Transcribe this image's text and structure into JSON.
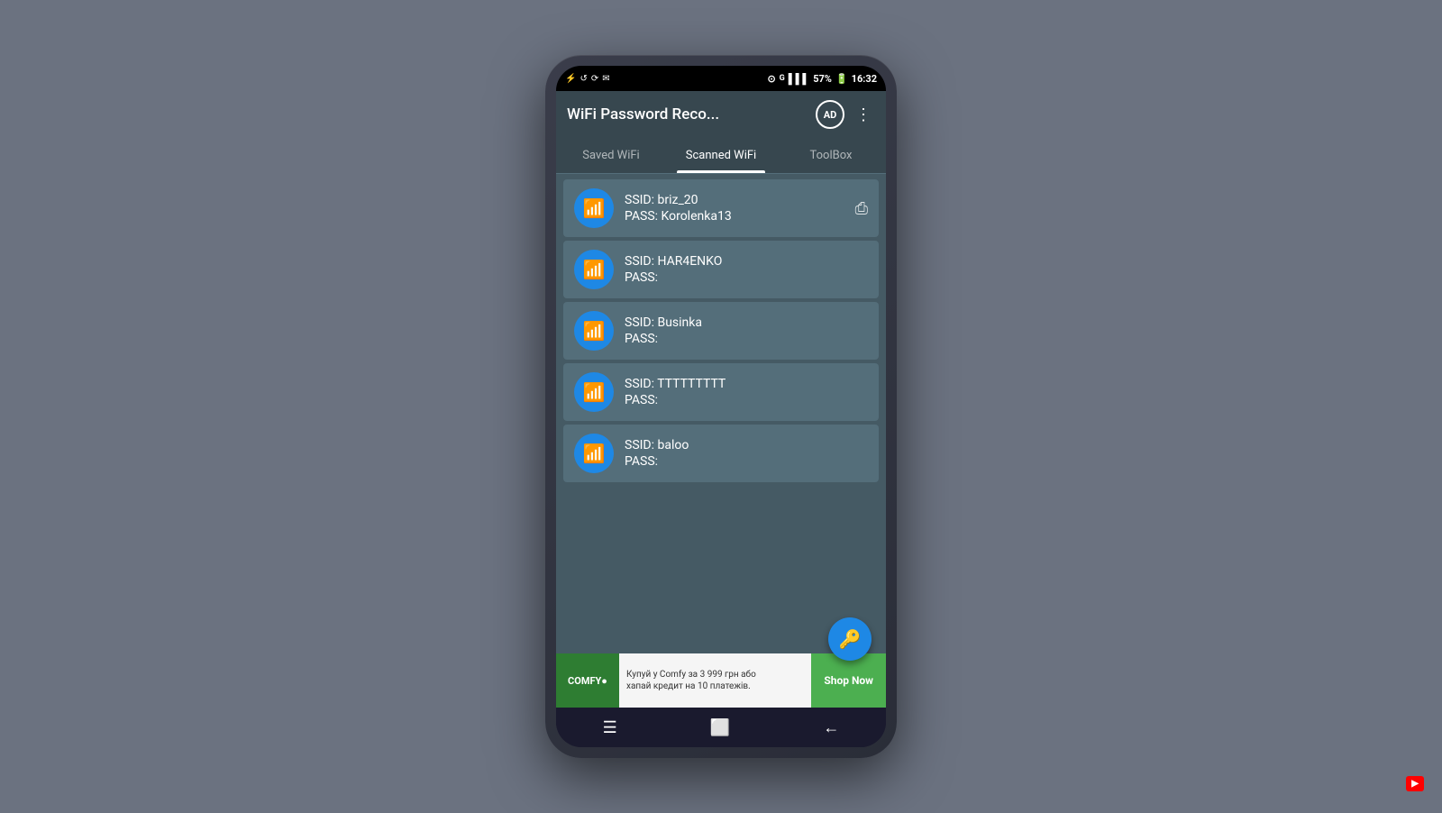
{
  "background": "#6b7280",
  "phone": {
    "status_bar": {
      "signal_icon": "▲",
      "wifi_icon": "⊙",
      "battery": "57%",
      "time": "16:32"
    },
    "app_bar": {
      "title": "WiFi Password Reco...",
      "ad_label": "AD",
      "more_icon": "⋮"
    },
    "tabs": [
      {
        "label": "Saved WiFi",
        "active": false
      },
      {
        "label": "Scanned WiFi",
        "active": true
      },
      {
        "label": "ToolBox",
        "active": false
      }
    ],
    "wifi_items": [
      {
        "ssid": "SSID: briz_20",
        "pass": "PASS: Korolenka13",
        "has_share": true
      },
      {
        "ssid": "SSID: HAR4ENKO",
        "pass": "PASS:",
        "has_share": false
      },
      {
        "ssid": "SSID: Businka",
        "pass": "PASS:",
        "has_share": false
      },
      {
        "ssid": "SSID: TTTTTTTTT",
        "pass": "PASS:",
        "has_share": false
      },
      {
        "ssid": "SSID: baloo",
        "pass": "PASS:",
        "has_share": false
      }
    ],
    "ad_banner": {
      "logo": "COMFY●",
      "text_line1": "Купуй у Comfy за 3 999 грн або",
      "text_line2": "хапай кредит на 10 платежів.",
      "button_label": "Shop Now"
    },
    "nav": {
      "menu_icon": "☰",
      "home_icon": "⬜",
      "back_icon": "←"
    }
  }
}
